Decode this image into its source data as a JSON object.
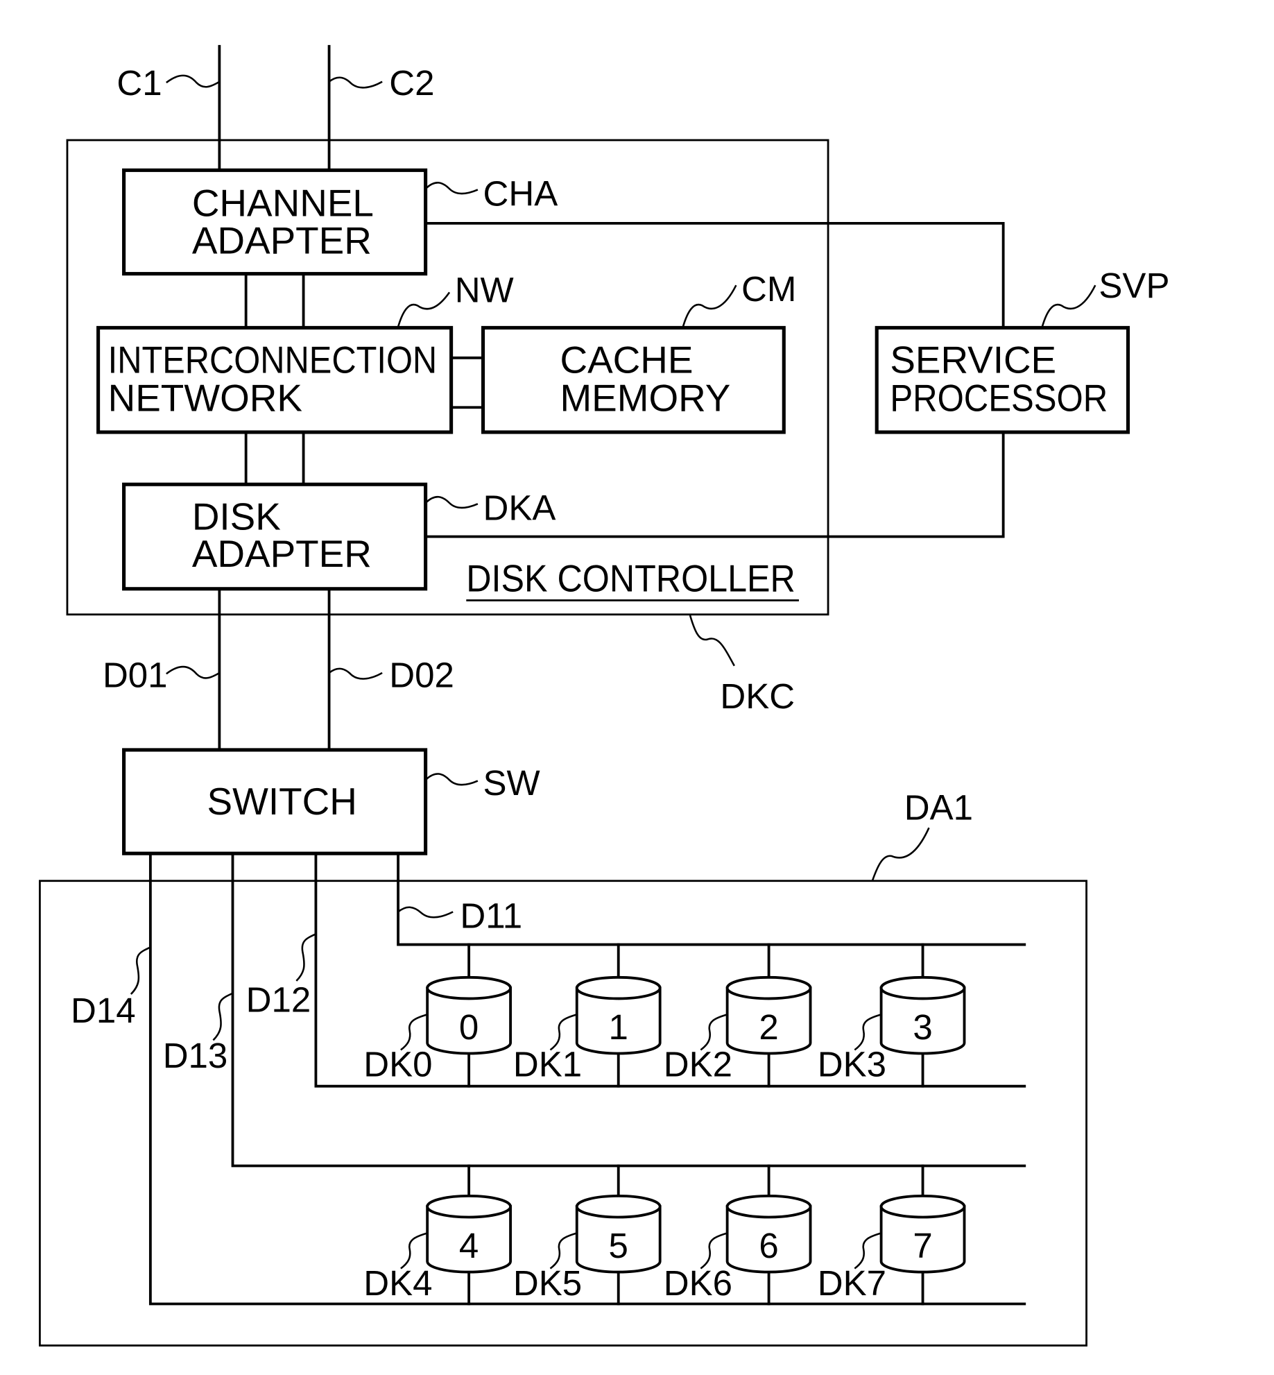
{
  "figure": {
    "channels": [
      {
        "id": "C1",
        "label": "C1"
      },
      {
        "id": "C2",
        "label": "C2"
      }
    ],
    "disk_controller": {
      "ref": "DKC",
      "title": "DISK CONTROLLER",
      "channel_adapter": {
        "ref": "CHA",
        "line1": "CHANNEL",
        "line2": "ADAPTER"
      },
      "interconnection_network": {
        "ref": "NW",
        "line1": "INTERCONNECTION",
        "line2": "NETWORK"
      },
      "cache_memory": {
        "ref": "CM",
        "line1": "CACHE",
        "line2": "MEMORY"
      },
      "disk_adapter": {
        "ref": "DKA",
        "line1": "DISK",
        "line2": "ADAPTER"
      }
    },
    "service_processor": {
      "ref": "SVP",
      "line1": "SERVICE",
      "line2": "PROCESSOR"
    },
    "disk_paths": [
      {
        "id": "D01",
        "label": "D01"
      },
      {
        "id": "D02",
        "label": "D02"
      }
    ],
    "switch": {
      "ref": "SW",
      "label": "SWITCH"
    },
    "disk_array": {
      "ref": "DA1",
      "buses": [
        {
          "id": "D11",
          "label": "D11"
        },
        {
          "id": "D12",
          "label": "D12"
        },
        {
          "id": "D13",
          "label": "D13"
        },
        {
          "id": "D14",
          "label": "D14"
        }
      ],
      "disks": [
        {
          "ref": "DK0",
          "number": "0"
        },
        {
          "ref": "DK1",
          "number": "1"
        },
        {
          "ref": "DK2",
          "number": "2"
        },
        {
          "ref": "DK3",
          "number": "3"
        },
        {
          "ref": "DK4",
          "number": "4"
        },
        {
          "ref": "DK5",
          "number": "5"
        },
        {
          "ref": "DK6",
          "number": "6"
        },
        {
          "ref": "DK7",
          "number": "7"
        }
      ]
    }
  }
}
